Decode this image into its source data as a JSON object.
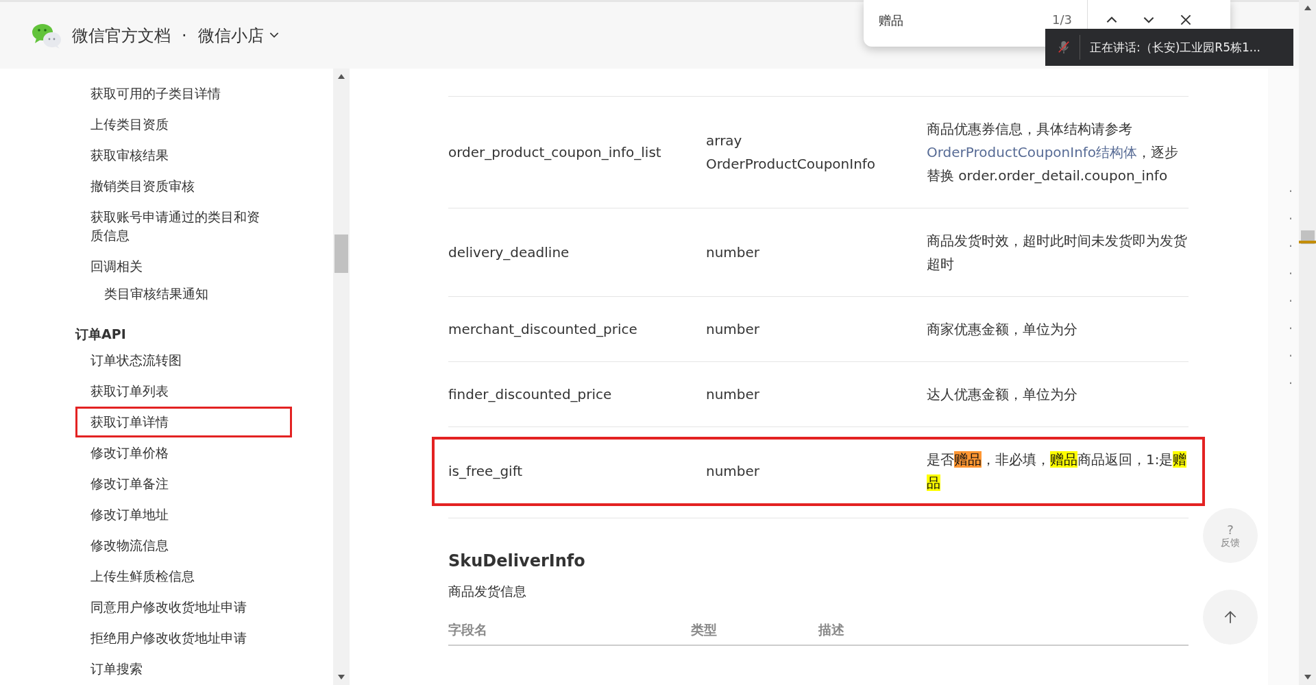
{
  "header": {
    "site_title": "微信官方文档",
    "separator": "·",
    "product": "微信小店"
  },
  "find_bar": {
    "query": "赠品",
    "count": "1/3"
  },
  "toast": {
    "muted": true,
    "text": "正在讲话:（长安)工业园R5栋1..."
  },
  "sidebar": {
    "items": [
      {
        "kind": "item",
        "label": "获取可用的子类目详情",
        "boxed": false
      },
      {
        "kind": "item",
        "label": "上传类目资质",
        "boxed": false
      },
      {
        "kind": "item",
        "label": "获取审核结果",
        "boxed": false
      },
      {
        "kind": "item",
        "label": "撤销类目资质审核",
        "boxed": false
      },
      {
        "kind": "item",
        "label": "获取账号申请通过的类目和资质信息",
        "boxed": false
      },
      {
        "kind": "item",
        "label": "回调相关",
        "boxed": false,
        "children": [
          {
            "label": "类目审核结果通知",
            "boxed": false
          }
        ]
      },
      {
        "kind": "section",
        "label": "订单API",
        "boxed": false
      },
      {
        "kind": "item",
        "label": "订单状态流转图",
        "boxed": false
      },
      {
        "kind": "item",
        "label": "获取订单列表",
        "boxed": false
      },
      {
        "kind": "item",
        "label": "获取订单详情",
        "boxed": true
      },
      {
        "kind": "item",
        "label": "修改订单价格",
        "boxed": false
      },
      {
        "kind": "item",
        "label": "修改订单备注",
        "boxed": false
      },
      {
        "kind": "item",
        "label": "修改订单地址",
        "boxed": false
      },
      {
        "kind": "item",
        "label": "修改物流信息",
        "boxed": false
      },
      {
        "kind": "item",
        "label": "上传生鲜质检信息",
        "boxed": false
      },
      {
        "kind": "item",
        "label": "同意用户修改收货地址申请",
        "boxed": false
      },
      {
        "kind": "item",
        "label": "拒绝用户修改收货地址申请",
        "boxed": false
      },
      {
        "kind": "item",
        "label": "订单搜索",
        "boxed": false
      }
    ]
  },
  "table": {
    "rows": [
      {
        "field": "order_product_coupon_info_list",
        "type": "array OrderProductCouponInfo",
        "boxed": false,
        "description": [
          {
            "kind": "text",
            "text": "商品优惠券信息，具体结构请参考"
          },
          {
            "kind": "link",
            "text": "OrderProductCouponInfo结构体"
          },
          {
            "kind": "text",
            "text": "，逐步替换 order.order_detail.coupon_info"
          }
        ]
      },
      {
        "field": "delivery_deadline",
        "type": "number",
        "boxed": false,
        "description": [
          {
            "kind": "text",
            "text": "商品发货时效，超时此时间未发货即为发货超时"
          }
        ]
      },
      {
        "field": "merchant_discounted_price",
        "type": "number",
        "boxed": false,
        "description": [
          {
            "kind": "text",
            "text": "商家优惠金额，单位为分"
          }
        ]
      },
      {
        "field": "finder_discounted_price",
        "type": "number",
        "boxed": false,
        "description": [
          {
            "kind": "text",
            "text": "达人优惠金额，单位为分"
          }
        ]
      },
      {
        "field": "is_free_gift",
        "type": "number",
        "boxed": true,
        "description": [
          {
            "kind": "text",
            "text": "是否"
          },
          {
            "kind": "match",
            "text": "赠品",
            "selected": true
          },
          {
            "kind": "text",
            "text": "，非必填，"
          },
          {
            "kind": "match",
            "text": "赠品",
            "selected": false
          },
          {
            "kind": "text",
            "text": "商品返回，1:是"
          },
          {
            "kind": "match",
            "text": "赠品",
            "selected": false
          }
        ]
      }
    ]
  },
  "section": {
    "title": "SkuDeliverInfo",
    "subtitle": "商品发货信息",
    "columns": [
      "字段名",
      "类型",
      "描述"
    ]
  },
  "toc": {
    "bullets": [
      "·",
      "·",
      "·",
      "·",
      "·",
      "·",
      "·",
      "·"
    ]
  },
  "float_buttons": {
    "feedback_mark": "?",
    "feedback_label": "反馈"
  }
}
